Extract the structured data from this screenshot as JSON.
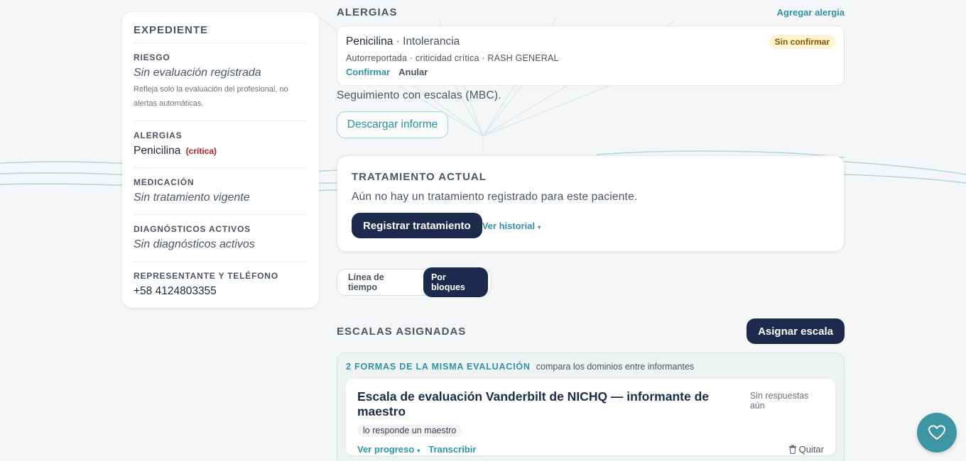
{
  "sidebar": {
    "title": "EXPEDIENTE",
    "risk": {
      "label": "RIESGO",
      "value": "Sin evaluación registrada",
      "note": "Refleja solo la evaluación del profesional, no alertas automáticas."
    },
    "allergies": {
      "label": "ALERGIAS",
      "value": "Penicilina",
      "criticality": "(crítica)"
    },
    "medication": {
      "label": "MEDICACIÓN",
      "value": "Sin tratamiento vigente"
    },
    "diagnoses": {
      "label": "DIAGNÓSTICOS ACTIVOS",
      "value": "Sin diagnósticos activos"
    },
    "representative": {
      "label": "REPRESENTANTE Y TELÉFONO",
      "value": "+58 4124803355"
    }
  },
  "allergies_section": {
    "heading": "ALERGIAS",
    "add_link": "Agregar alergia",
    "item": {
      "name": "Penicilina",
      "type": " · Intolerancia",
      "status": "Sin confirmar",
      "meta": "Autorreportada · criticidad crítica · RASH GENERAL",
      "confirm": "Confirmar",
      "cancel": "Anular"
    }
  },
  "followup_text": "Seguimiento con escalas (MBC).",
  "download_button": "Descargar informe",
  "treatment": {
    "heading": "TRATAMIENTO ACTUAL",
    "empty_text": "Aún no hay un tratamiento registrado para este paciente.",
    "register_button": "Registrar tratamiento",
    "history_link": "Ver historial",
    "caret": "▾"
  },
  "view_toggle": {
    "options": [
      "Línea de tiempo",
      "Por bloques"
    ],
    "selected": "Por bloques"
  },
  "scales": {
    "heading": "ESCALAS ASIGNADAS",
    "assign_button": "Asignar escala",
    "group": {
      "title": "2 FORMAS DE LA MISMA EVALUACIÓN",
      "subtitle": "compara los dominios entre informantes",
      "card": {
        "title": "Escala de evaluación Vanderbilt de NICHQ — informante de maestro",
        "status": "Sin respuestas aún",
        "respondent": "lo responde un maestro",
        "progress_link": "Ver progreso",
        "caret": "▾",
        "transcribe_link": "Transcribir",
        "remove": "Quitar"
      }
    }
  },
  "icons": {
    "fab": "heart-icon",
    "remove": "trash-icon"
  },
  "colors": {
    "primary": "#1c2b4d",
    "accent": "#2e93a6",
    "fab": "#3e96a4",
    "critical": "#b91c1c"
  }
}
